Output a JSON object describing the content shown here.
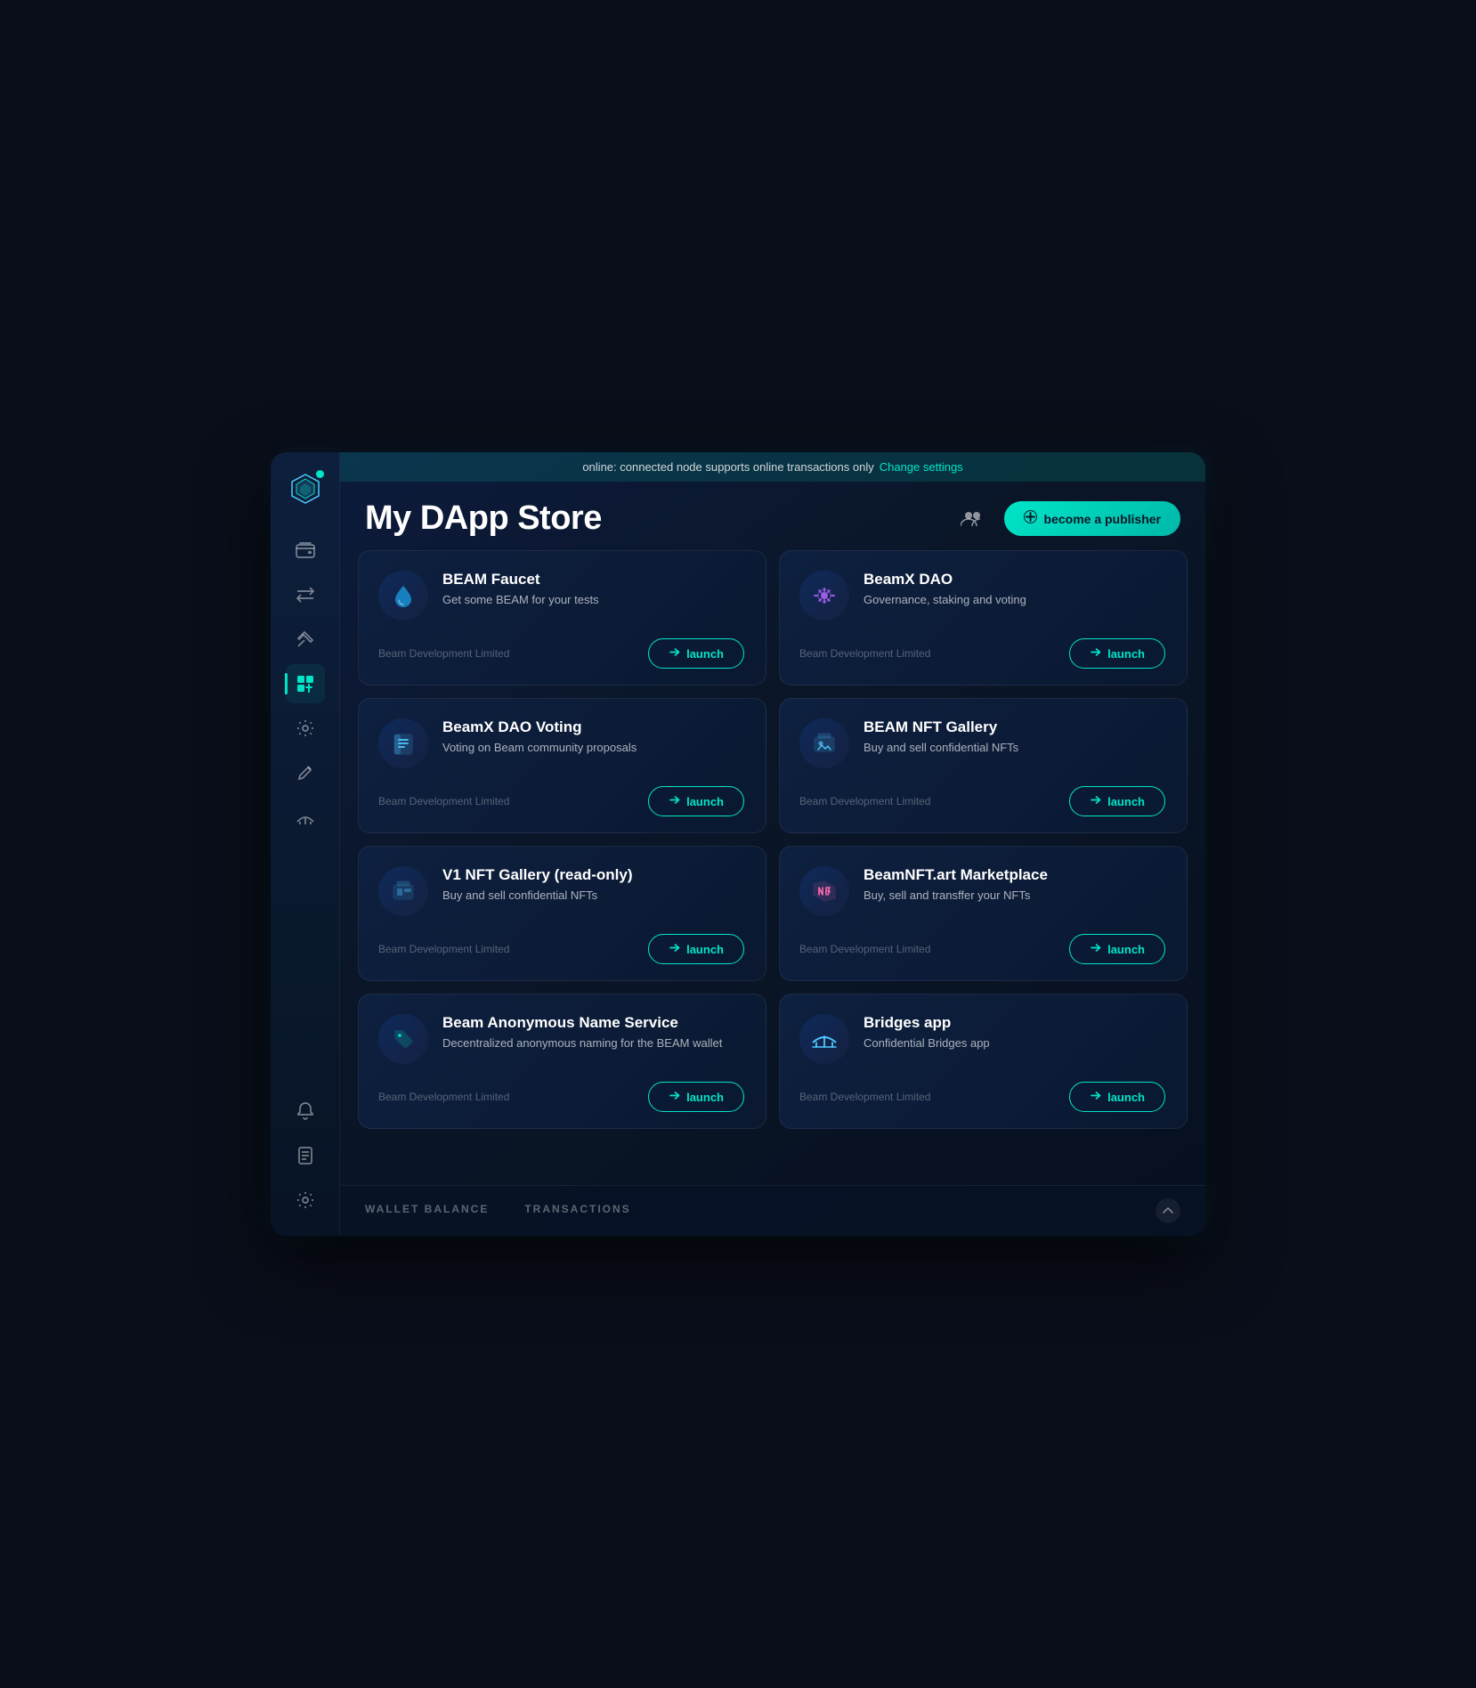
{
  "topbar": {
    "status_text": "online: connected node supports online transactions only",
    "link_text": "Change settings"
  },
  "header": {
    "title": "My DApp Store",
    "people_icon": "people-icon",
    "publisher_btn_icon": "➕",
    "publisher_btn_label": "become a publisher"
  },
  "dapps": [
    {
      "id": "beam-faucet",
      "name": "BEAM Faucet",
      "description": "Get some BEAM for your tests",
      "publisher": "Beam Development Limited",
      "launch_label": "launch",
      "icon_type": "droplet",
      "icon_color": "#1a90d4"
    },
    {
      "id": "beamx-dao",
      "name": "BeamX DAO",
      "description": "Governance, staking and voting",
      "publisher": "Beam Development Limited",
      "launch_label": "launch",
      "icon_type": "gear",
      "icon_color": "#9b5de5"
    },
    {
      "id": "beamx-dao-voting",
      "name": "BeamX DAO Voting",
      "description": "Voting on Beam community proposals",
      "publisher": "Beam Development Limited",
      "launch_label": "launch",
      "icon_type": "ballot",
      "icon_color": "#4ec9ff"
    },
    {
      "id": "beam-nft-gallery",
      "name": "BEAM NFT Gallery",
      "description": "Buy and sell confidential NFTs",
      "publisher": "Beam Development Limited",
      "launch_label": "launch",
      "icon_type": "gallery",
      "icon_color": "#4ec9ff"
    },
    {
      "id": "v1-nft-gallery",
      "name": "V1 NFT Gallery (read-only)",
      "description": "Buy and sell confidential NFTs",
      "publisher": "Beam Development Limited",
      "launch_label": "launch",
      "icon_type": "gallery2",
      "icon_color": "#4ec9ff"
    },
    {
      "id": "beamnft-art",
      "name": "BeamNFT.art Marketplace",
      "description": "Buy, sell and transffer your NFTs",
      "publisher": "Beam Development Limited",
      "launch_label": "launch",
      "icon_type": "nft",
      "icon_color": "#ff6bb0"
    },
    {
      "id": "beam-name-service",
      "name": "Beam Anonymous Name Service",
      "description": "Decentralized anonymous naming for the BEAM wallet",
      "publisher": "Beam Development Limited",
      "launch_label": "launch",
      "icon_type": "tag",
      "icon_color": "#00e5c8"
    },
    {
      "id": "bridges-app",
      "name": "Bridges app",
      "description": "Confidential Bridges app",
      "publisher": "Beam Development Limited",
      "launch_label": "launch",
      "icon_type": "bridge",
      "icon_color": "#4ec9ff"
    }
  ],
  "bottom_tabs": [
    {
      "label": "WALLET BALANCE",
      "active": false
    },
    {
      "label": "TRANSACTIONS",
      "active": false
    }
  ],
  "sidebar": {
    "items": [
      {
        "icon": "wallet",
        "active": false,
        "label": "Wallet"
      },
      {
        "icon": "swap",
        "active": false,
        "label": "Swap"
      },
      {
        "icon": "atomic-swap",
        "active": false,
        "label": "Atomic Swap"
      },
      {
        "icon": "dapp-store",
        "active": true,
        "label": "DApp Store"
      },
      {
        "icon": "settings-gear",
        "active": false,
        "label": "Settings"
      },
      {
        "icon": "sign",
        "active": false,
        "label": "Sign"
      },
      {
        "icon": "bridge",
        "active": false,
        "label": "Bridge"
      },
      {
        "icon": "notifications",
        "active": false,
        "label": "Notifications"
      },
      {
        "icon": "report",
        "active": false,
        "label": "Report"
      },
      {
        "icon": "app-settings",
        "active": false,
        "label": "App Settings"
      }
    ]
  },
  "colors": {
    "accent": "#00e5c8",
    "bg_dark": "#071020",
    "bg_card": "#0e2040",
    "sidebar_bg": "#0d1f3c"
  }
}
